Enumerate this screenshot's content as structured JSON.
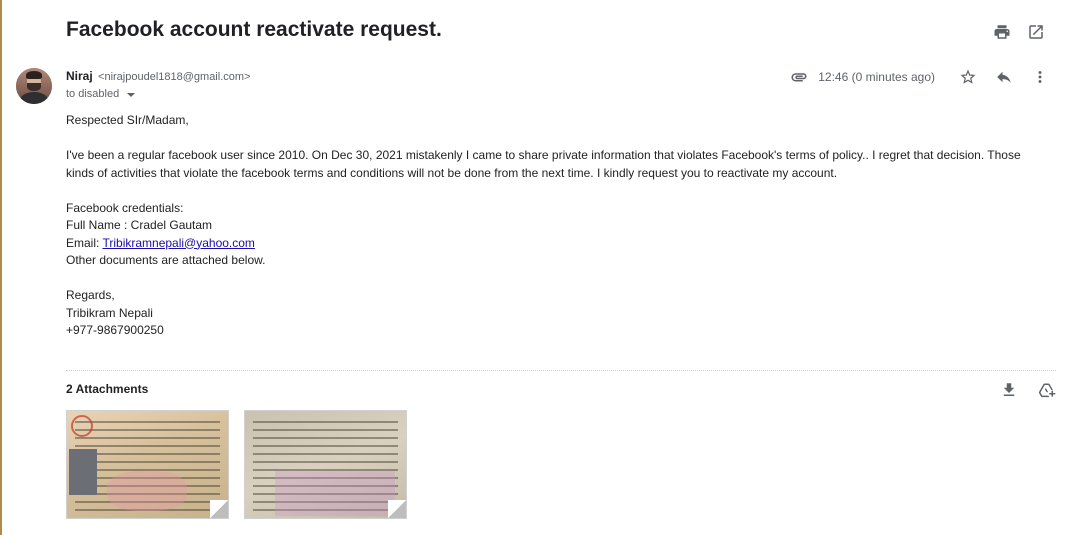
{
  "email": {
    "subject": "Facebook account reactivate request.",
    "sender_name": "Niraj",
    "sender_email": "<nirajpoudel1818@gmail.com>",
    "to_label": "to disabled",
    "time": "12:46 (0 minutes ago)",
    "body": {
      "greeting": "Respected SIr/Madam,",
      "paragraph": "I've been a regular facebook user since 2010. On Dec 30, 2021 mistakenly I came to share private information that violates Facebook's terms of policy.. I regret that decision. Those kinds of activities that violate the facebook terms and conditions will not be done from the next time. I kindly request you to reactivate my account.",
      "credentials_heading": "Facebook credentials:",
      "full_name_line": "Full Name : Cradel Gautam",
      "email_label": "Email: ",
      "email_link": "Tribikramnepali@yahoo.com",
      "documents_line": "Other documents are attached below.",
      "regards": "Regards,",
      "signature_name": "Tribikram Nepali",
      "signature_phone": "+977-9867900250"
    }
  },
  "attachments": {
    "title": "2 Attachments",
    "items": [
      {
        "kind": "scanned-document-image"
      },
      {
        "kind": "scanned-document-image"
      }
    ]
  },
  "icons": {
    "print": "print-icon",
    "open_new_window": "open-in-new-icon",
    "attachment": "paperclip-icon",
    "star": "star-icon",
    "reply": "reply-icon",
    "more": "more-vert-icon",
    "download": "download-icon",
    "add_to_drive": "add-to-drive-icon"
  },
  "colors": {
    "link": "#1a0dab",
    "icon": "#5f6368",
    "text": "#222222"
  }
}
